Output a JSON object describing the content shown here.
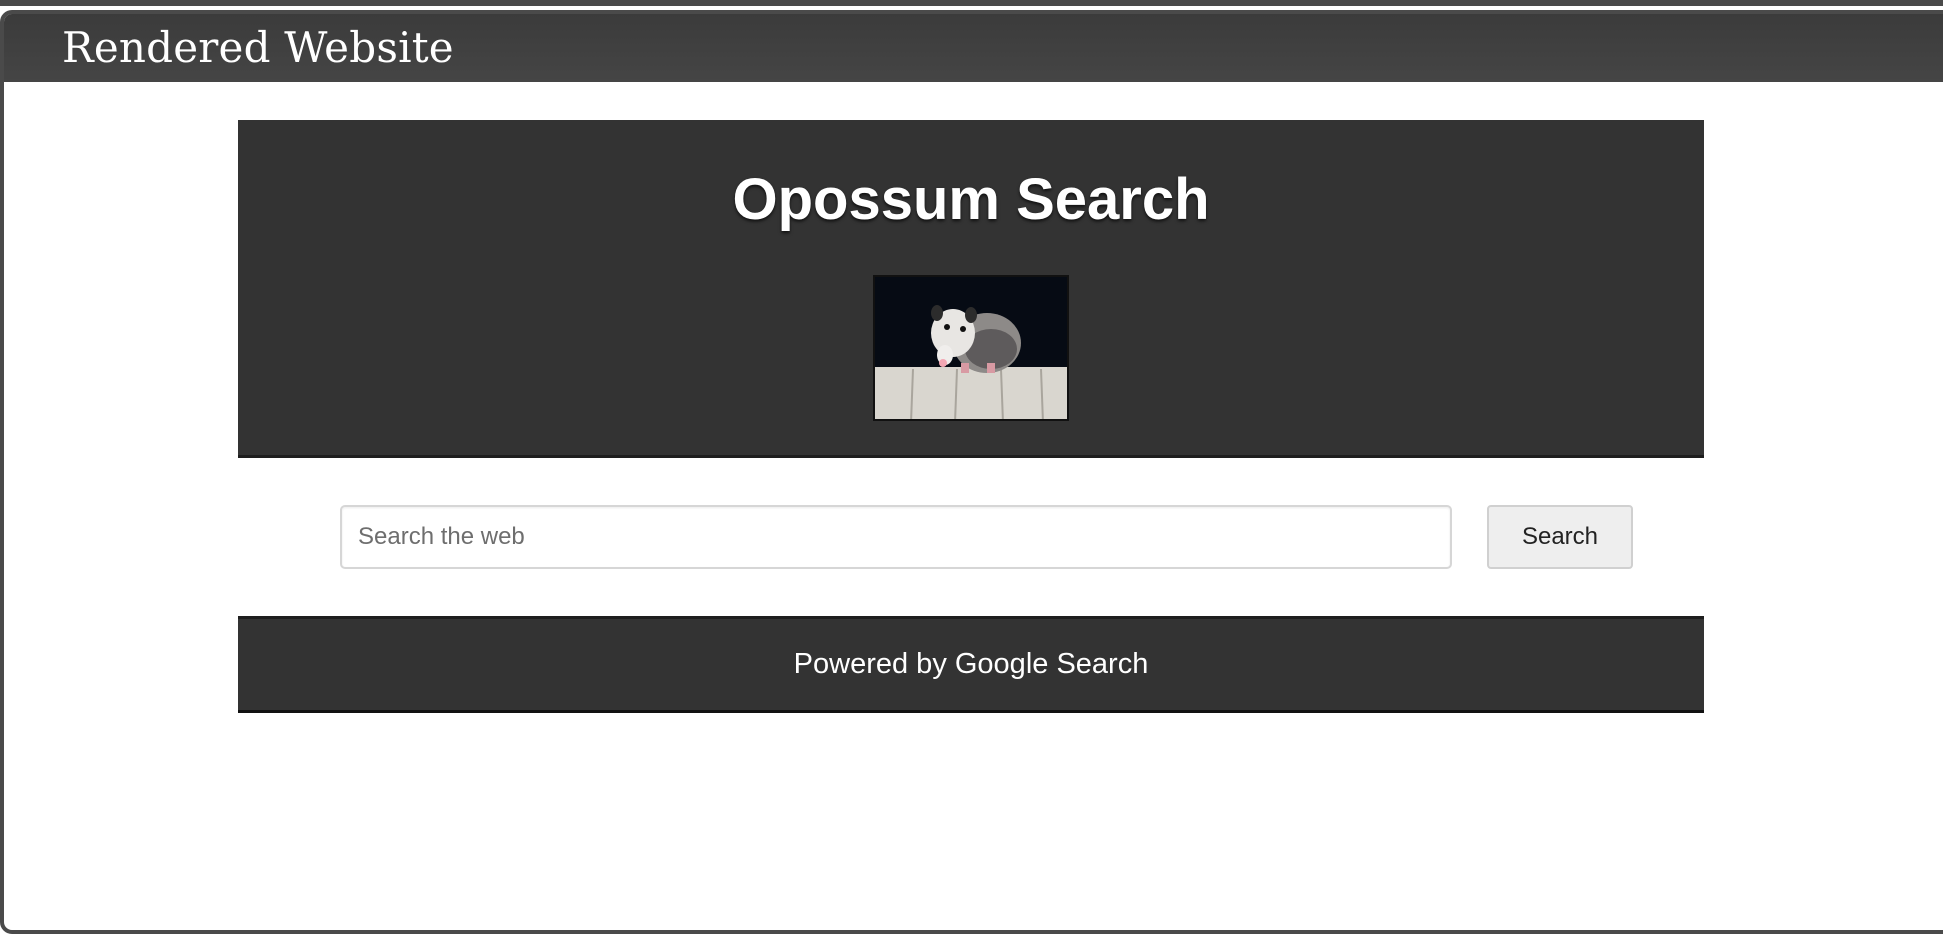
{
  "window": {
    "title": "Rendered Website"
  },
  "site": {
    "title": "Opossum Search",
    "logo_icon": "opossum-on-fence-photo"
  },
  "search": {
    "placeholder": "Search the web",
    "value": "",
    "button_label": "Search"
  },
  "footer": {
    "text": "Powered by Google Search"
  },
  "colors": {
    "header_bg": "#333333",
    "frame_border": "#4a4a4a",
    "button_bg": "#eeeeee"
  }
}
